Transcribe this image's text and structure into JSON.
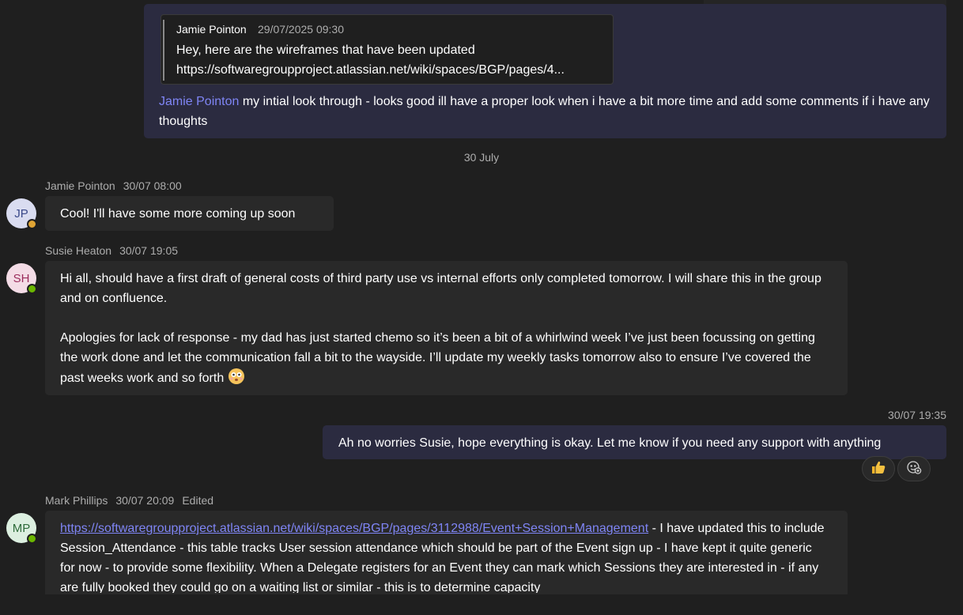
{
  "top_message": {
    "quote_author": "Jamie Pointon",
    "quote_time": "29/07/2025 09:30",
    "quote_line1": "Hey, here are the wireframes that have been updated",
    "quote_line2": "https://softwaregroupproject.atlassian.net/wiki/spaces/BGP/pages/4...",
    "mention": "Jamie Pointon",
    "text": " my intial look through - looks good ill have a proper look when i have a bit more time and add some comments if i have any thoughts"
  },
  "date_divider": "30 July",
  "messages": [
    {
      "author": "Jamie Pointon",
      "time": "30/07 08:00",
      "initials": "JP",
      "avatar_bg": "#d9dcf0",
      "avatar_fg": "#3b4a8a",
      "status_color": "#e0a434",
      "text": "Cool! I'll have some more coming up soon"
    },
    {
      "author": "Susie Heaton",
      "time": "30/07 19:05",
      "initials": "SH",
      "avatar_bg": "#f4dce6",
      "avatar_fg": "#9b2d5c",
      "status_color": "#6bb700",
      "para1": "Hi all, should have a first draft of general costs of third party use vs internal efforts only completed tomorrow. I will share this in the group and on confluence.",
      "para2": "Apologies for lack of response - my dad has just started chemo so it’s been a bit of a whirlwind week I’ve just been focussing on getting the work done and let the communication fall a bit to the wayside. I’ll update my weekly tasks tomorrow also to ensure I’ve covered the past weeks work and so forth"
    },
    {
      "author": "Mark Phillips",
      "time": "30/07 20:09",
      "edited": "Edited",
      "initials": "MP",
      "avatar_bg": "#dcefe0",
      "avatar_fg": "#2e6b3a",
      "status_color": "#6bb700",
      "link": "https://softwaregroupproject.atlassian.net/wiki/spaces/BGP/pages/3112988/Event+Session+Management",
      "text": " - I have updated this to include Session_Attendance - this table tracks User session attendance which should be part of the Event sign up - I have kept it quite generic for now - to provide some flexibility. When a Delegate registers for an Event they can mark which Sessions they are interested in - if any are fully booked they could go on a waiting list or similar - this is to determine capacity"
    }
  ],
  "own_reply": {
    "time": "30/07 19:35",
    "text": "Ah no worries Susie, hope everything is okay. Let me know if you need any support with anything"
  },
  "reactions": {
    "like_icon": "thumbs-up-icon",
    "add_icon": "add-reaction-icon"
  },
  "colors": {
    "background": "#1f1f1f",
    "own_bubble": "#2b2b40",
    "other_bubble": "#292929",
    "accent": "#7f85f5"
  }
}
